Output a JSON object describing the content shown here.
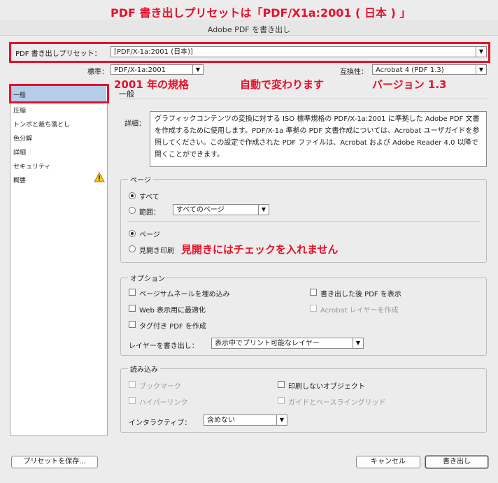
{
  "annotations": {
    "top": "PDF 書き出しプリセットは「PDF/X1a:2001 ( 日本 ) 」",
    "standard_note": "2001 年の規格",
    "auto_note": "自動で変わります",
    "version_note": "バージョン 1.3",
    "spread_note": "見開きにはチェックを入れません"
  },
  "window": {
    "title": "Adobe PDF を書き出し"
  },
  "preset": {
    "label": "PDF 書き出しプリセット：",
    "value": "[PDF/X-1a:2001 (日本)]"
  },
  "standard": {
    "label": "標準：",
    "value": "PDF/X-1a:2001"
  },
  "compat": {
    "label": "互換性：",
    "value": "Acrobat 4 (PDF 1.3)"
  },
  "sidebar": {
    "items": [
      {
        "label": "一般"
      },
      {
        "label": "圧縮"
      },
      {
        "label": "トンボと裁ち落とし"
      },
      {
        "label": "色分解"
      },
      {
        "label": "詳細"
      },
      {
        "label": "セキュリティ"
      },
      {
        "label": "概要"
      }
    ]
  },
  "panel": {
    "title": "一般",
    "desc_label": "詳細：",
    "description": "グラフィックコンテンツの変換に対する ISO 標準規格の PDF/X-1a:2001 に準拠した Adobe PDF 文書を作成するために使用します。PDF/X-1a 準拠の PDF 文書作成については、Acrobat ユーザガイドを参照してください。この設定で作成された PDF ファイルは、Acrobat および Adobe Reader 4.0 以降で開くことができます。"
  },
  "pages": {
    "title": "ページ",
    "all": "すべて",
    "range": "範囲：",
    "range_value": "すべてのページ",
    "page": "ページ",
    "spread": "見開き印刷"
  },
  "options": {
    "title": "オプション",
    "embed_thumbs": "ページサムネールを埋め込み",
    "view_after": "書き出した後 PDF を表示",
    "web_opt": "Web 表示用に最適化",
    "acrobat_layers": "Acrobat レイヤーを作成",
    "tagged": "タグ付き PDF を作成",
    "export_layers": "レイヤーを書き出し：",
    "export_layers_value": "表示中でプリント可能なレイヤー"
  },
  "include": {
    "title": "読み込み",
    "bookmarks": "ブックマーク",
    "nonprint": "印刷しないオブジェクト",
    "hyperlinks": "ハイパーリンク",
    "guides": "ガイドとベースライングリッド",
    "interactive": "インタラクティブ：",
    "interactive_value": "含めない"
  },
  "footer": {
    "save_preset": "プリセットを保存...",
    "cancel": "キャンセル",
    "export": "書き出し"
  }
}
